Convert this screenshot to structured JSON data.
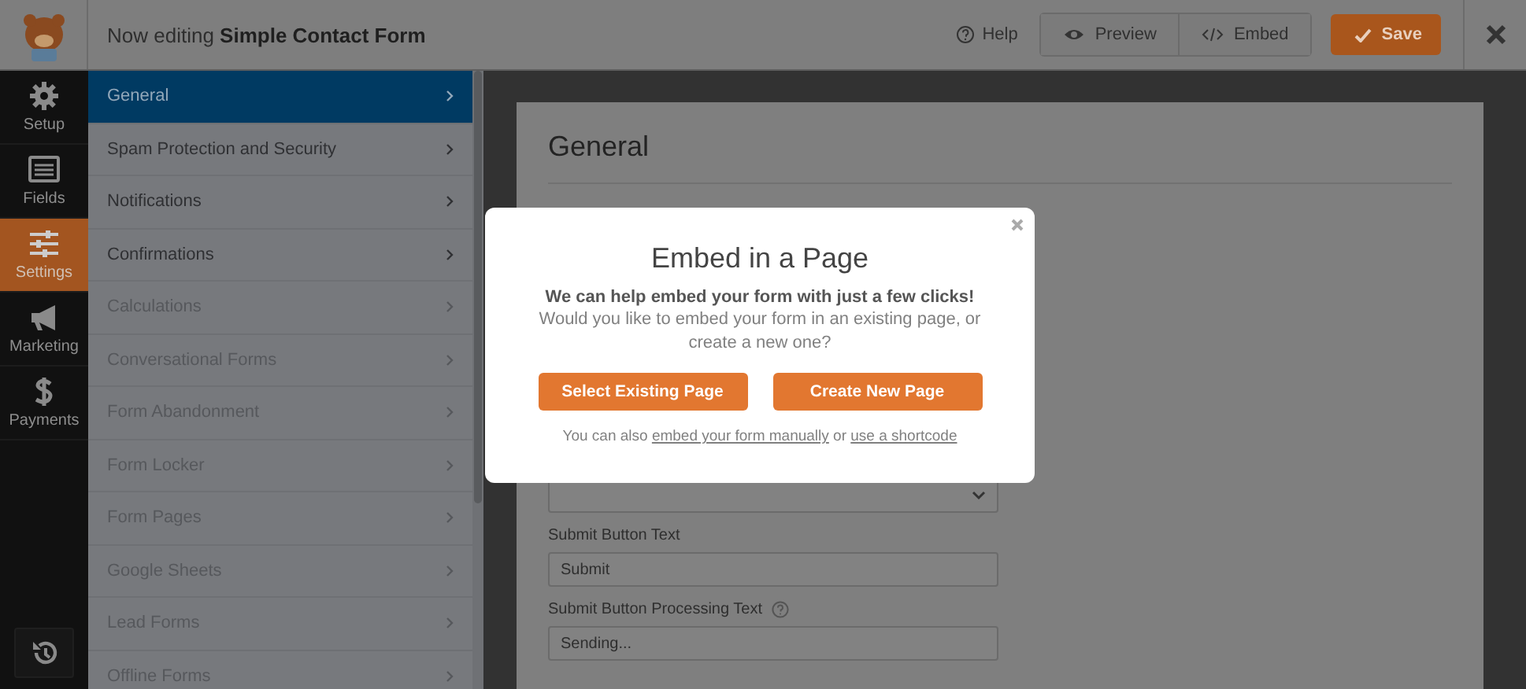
{
  "header": {
    "title": "Now editing **Simple Contact Form**",
    "help": "Help",
    "preview": "Preview",
    "embed": "Embed",
    "save": "Save"
  },
  "nav": [
    {
      "kind": "gear",
      "label": "Setup",
      "selected": false
    },
    {
      "kind": "list",
      "label": "Fields",
      "selected": false
    },
    {
      "kind": "sliders",
      "label": "Settings",
      "selected": true
    },
    {
      "kind": "megaphone",
      "label": "Marketing",
      "selected": false
    },
    {
      "kind": "dollar",
      "label": "Payments",
      "selected": false
    }
  ],
  "settings_menu": [
    {
      "label": "General",
      "selected": true,
      "disabled": false
    },
    {
      "label": "Spam Protection and Security",
      "selected": false,
      "disabled": false
    },
    {
      "label": "Notifications",
      "selected": false,
      "disabled": false
    },
    {
      "label": "Confirmations",
      "selected": false,
      "disabled": false
    },
    {
      "label": "Calculations",
      "selected": false,
      "disabled": true
    },
    {
      "label": "Conversational Forms",
      "selected": false,
      "disabled": true
    },
    {
      "label": "Form Abandonment",
      "selected": false,
      "disabled": true
    },
    {
      "label": "Form Locker",
      "selected": false,
      "disabled": true
    },
    {
      "label": "Form Pages",
      "selected": false,
      "disabled": true
    },
    {
      "label": "Google Sheets",
      "selected": false,
      "disabled": true
    },
    {
      "label": "Lead Forms",
      "selected": false,
      "disabled": true
    },
    {
      "label": "Offline Forms",
      "selected": false,
      "disabled": true
    }
  ],
  "panel": {
    "title": "General",
    "fields": [
      {
        "kind": "select"
      },
      {
        "kind": "text",
        "label": "Submit Button Text",
        "value": "Submit"
      },
      {
        "kind": "text",
        "label": "Submit Button Processing Text",
        "help": true,
        "value": "Sending..."
      }
    ]
  },
  "modal": {
    "title": "Embed in a Page",
    "lead": "We can help embed your form with just a few clicks!",
    "text": "Would you like to embed your form in an existing page, or create a new one?",
    "buttons": [
      "Select Existing Page",
      "Create New Page"
    ],
    "footer": {
      "before": "You can also",
      "link_1": "embed your form manually",
      "middle": "or",
      "link_2": "use a shortcode"
    }
  }
}
